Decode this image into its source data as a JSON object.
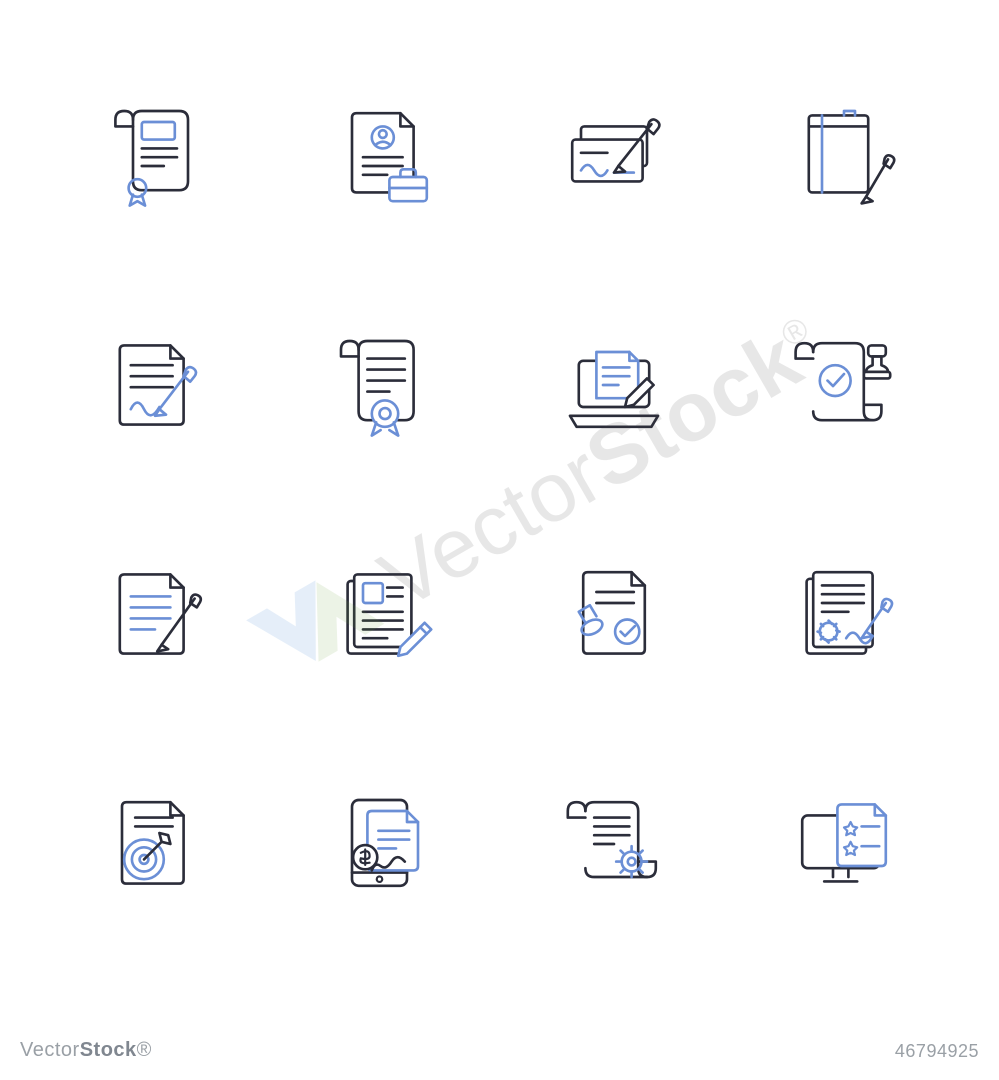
{
  "colors": {
    "dark": "#2b2d3a",
    "blue": "#6b8fd6",
    "wm_blue": "#2f7dd1",
    "wm_green": "#6aa038",
    "footer": "#9aa0a6"
  },
  "stroke_width": 2.4,
  "footer": {
    "brand_light": "Vector",
    "brand_bold": "Stock",
    "suffix": "®",
    "image_id": "46794925"
  },
  "watermark": {
    "text": "VectorStock®"
  },
  "icons": [
    {
      "name": "certificate-scroll-icon"
    },
    {
      "name": "resume-briefcase-icon"
    },
    {
      "name": "cheque-pen-icon"
    },
    {
      "name": "notebook-pen-icon"
    },
    {
      "name": "signed-document-icon"
    },
    {
      "name": "award-certificate-icon"
    },
    {
      "name": "laptop-edit-icon"
    },
    {
      "name": "approved-stamp-scroll-icon"
    },
    {
      "name": "edit-note-icon"
    },
    {
      "name": "form-pencil-icon"
    },
    {
      "name": "document-stamp-check-icon"
    },
    {
      "name": "contract-seal-sign-icon"
    },
    {
      "name": "target-document-icon"
    },
    {
      "name": "tablet-invoice-icon"
    },
    {
      "name": "scroll-gear-icon"
    },
    {
      "name": "monitor-rating-icon"
    }
  ]
}
